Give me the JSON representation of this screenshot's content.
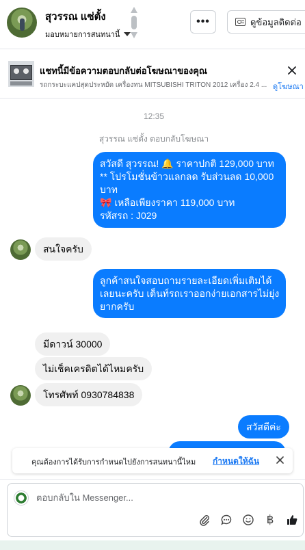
{
  "header": {
    "name": "สุวรรณ แซ่ตั้ง",
    "assign_label": "มอบหมายการสนทนานี้",
    "more_label": "•••",
    "contact_button_label": "ดูข้อมูลติดต่อ"
  },
  "ad": {
    "title": "แชทนี้มีข้อความตอบกลับต่อโฆษณาของคุณ",
    "subtitle": "รถกระบะแคปสุดประหยัด เครื่องทน MITSUBISHI TRITON 2012 เครื่อง 2.4 ...",
    "link_label": "ดูโฆษณา"
  },
  "chat": {
    "time": "12:35",
    "replied_note": "สุวรรณ แซ่ตั้ง ตอบกลับโฆษณา",
    "messages": [
      {
        "dir": "out",
        "lines": [
          "สวัสดี สุวรรณ! 🔔 ราคาปกติ 129,000 บาท",
          "** โปรโมชั่นข้าวแลกลด รับส่วนลด 10,000",
          "บาท",
          "🎀  เหลือเพียงราคา 119,000 บาท",
          " รหัสรถ : J029"
        ]
      },
      {
        "dir": "in",
        "text": "สนใจครับ"
      },
      {
        "dir": "out",
        "lines": [
          "ลูกค้าสนใจสอบถามรายละเอียดเพิ่มเติมได้",
          "เลยนะครับ เต็นท์รถเราออกง่ายเอกสารไม่ยุ่ง",
          "ยากครับ"
        ]
      },
      {
        "dir": "in",
        "text": "มีดาวน์  30000"
      },
      {
        "dir": "in",
        "text": "ไม่เช็คเครดิตได้ไหมครับ"
      },
      {
        "dir": "in",
        "text": "โทรศัพท์  0930784838"
      },
      {
        "dir": "out",
        "text": "สวัสดีค่ะ"
      },
      {
        "dir": "out",
        "text": ""
      }
    ]
  },
  "notice": {
    "text": "คุณต้องการได้รับการกำหนดไปยังการสนทนานี้ไหม",
    "link_label": "กำหนดให้ฉัน"
  },
  "composer": {
    "placeholder": "ตอบกลับใน Messenger...",
    "currency_symbol": "฿"
  },
  "colors": {
    "outgoing_bubble": "#0a7cff",
    "incoming_bubble": "#f0f0f0",
    "link": "#1877f2",
    "like_icon": "#1c1e21"
  },
  "icons": [
    "chevron-up-icon",
    "chevron-down-icon",
    "contact-card-icon",
    "close-icon",
    "attachment-icon",
    "saved-reply-icon",
    "emoji-icon",
    "baht-icon",
    "like-icon"
  ]
}
